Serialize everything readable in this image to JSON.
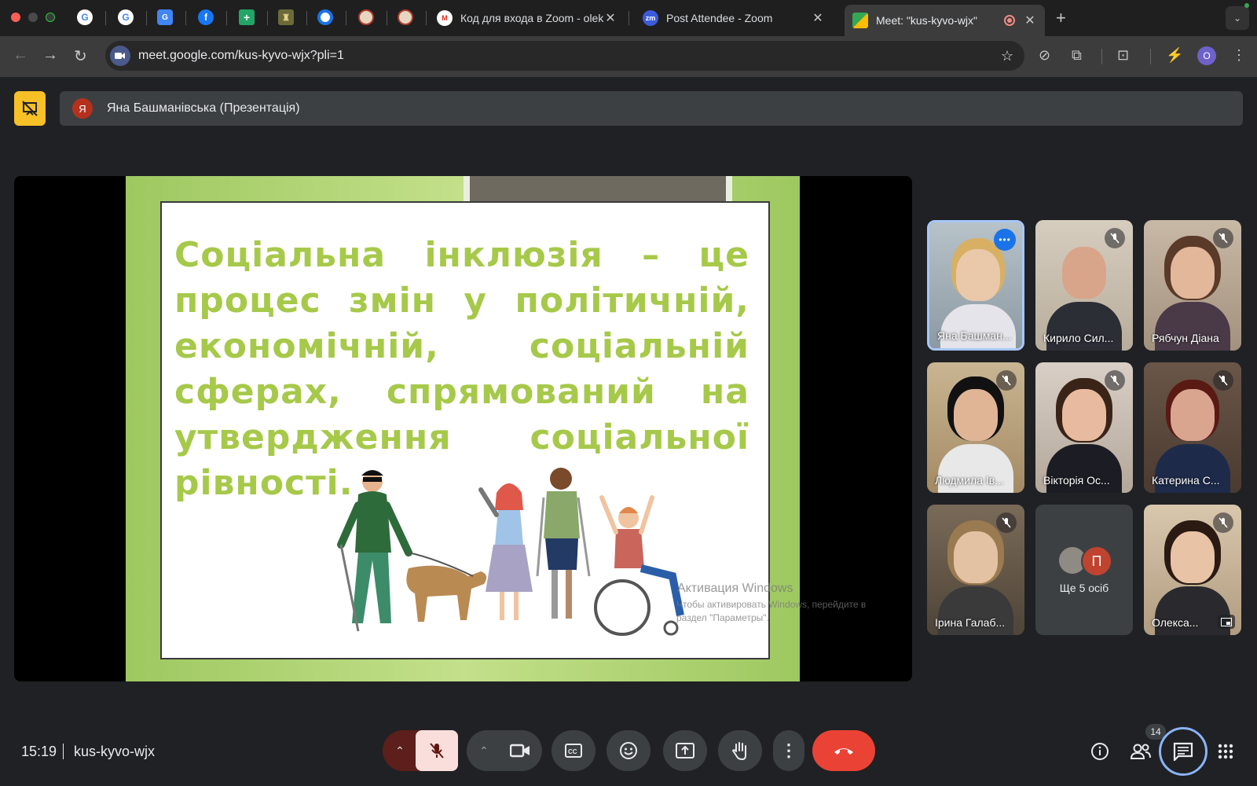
{
  "browser": {
    "tabs": [
      {
        "title": "Код для входа в Zoom - olek",
        "favicon": "gmail-icon"
      },
      {
        "title": "Post Attendee - Zoom",
        "favicon": "zoom-icon"
      },
      {
        "title": "Meet: \"kus-kyvo-wjx\"",
        "favicon": "meet-icon",
        "active": true
      }
    ],
    "pinned_tabs": [
      "google-icon",
      "google-icon",
      "translate-icon",
      "facebook-icon",
      "sheets-icon",
      "crest-icon",
      "target-icon",
      "seal-icon",
      "seal-icon"
    ],
    "url": "meet.google.com/kus-kyvo-wjx?pli=1",
    "profile_initial": "O"
  },
  "meet": {
    "presenter": {
      "initial": "Я",
      "label": "Яна Башманівська (Презентація)"
    },
    "slide": {
      "text": "Соціальна інклюзія – це процес змін у політичній, економічній, соціальній сферах, спрямований на утвердження соціальної рівності.",
      "watermark_title": "Активация Windows",
      "watermark_line1": "Чтобы активировать Windows, перейдите в",
      "watermark_line2": "раздел \"Параметры\"."
    },
    "participants": [
      {
        "name": "Яна Башман...",
        "speaking": true
      },
      {
        "name": "Кирило Сил..."
      },
      {
        "name": "Рябчун Діана"
      },
      {
        "name": "Людмила Ів..."
      },
      {
        "name": "Вікторія Ос..."
      },
      {
        "name": "Катерина С..."
      },
      {
        "name": "Ірина Галаб..."
      },
      {
        "name": "Олекса..."
      }
    ],
    "more": {
      "initial": "П",
      "label": "Ще 5 осіб"
    },
    "time": "15:19",
    "meeting_code": "kus-kyvo-wjx",
    "people_count": "14"
  },
  "colors": {
    "accent": "#a8c7fa",
    "slide_text": "#a6c94a",
    "hangup": "#ea4335",
    "pin": "#f6c026"
  }
}
